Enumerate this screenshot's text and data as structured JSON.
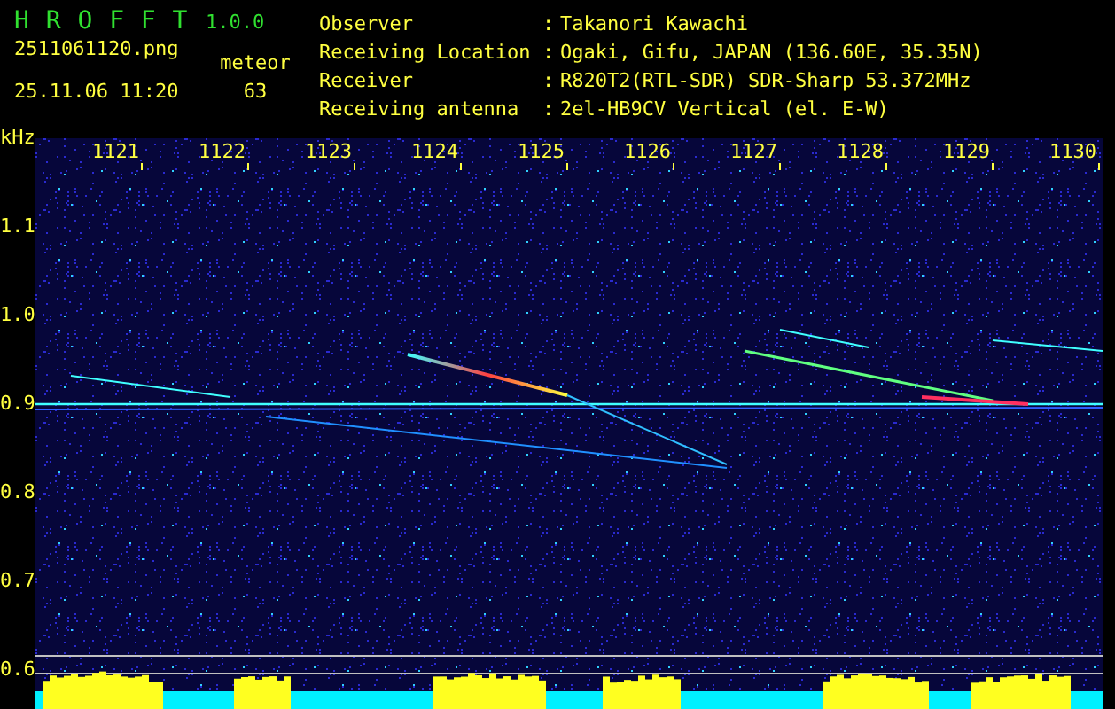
{
  "header": {
    "app_name": "H R O F F T",
    "version": "1.0.0",
    "filename": "2511061120.png",
    "datetime": "25.11.06 11:20",
    "count_label": "meteor",
    "count": "63",
    "info": [
      {
        "label": "Observer",
        "sep": ":",
        "value": "Takanori Kawachi"
      },
      {
        "label": "Receiving Location",
        "sep": ":",
        "value": "Ogaki, Gifu, JAPAN (136.60E, 35.35N)"
      },
      {
        "label": "Receiver",
        "sep": ":",
        "value": "R820T2(RTL-SDR) SDR-Sharp 53.372MHz"
      },
      {
        "label": "Receiving antenna",
        "sep": ":",
        "value": "2el-HB9CV Vertical (el. E-W)"
      }
    ]
  },
  "spectrogram": {
    "y_unit": "kHz",
    "x_ticks": [
      "1121",
      "1122",
      "1123",
      "1124",
      "1125",
      "1126",
      "1127",
      "1128",
      "1129",
      "1130"
    ],
    "y_ticks": [
      "1.1",
      "1.0",
      "0.9",
      "0.8",
      "0.7",
      "0.6"
    ]
  }
}
